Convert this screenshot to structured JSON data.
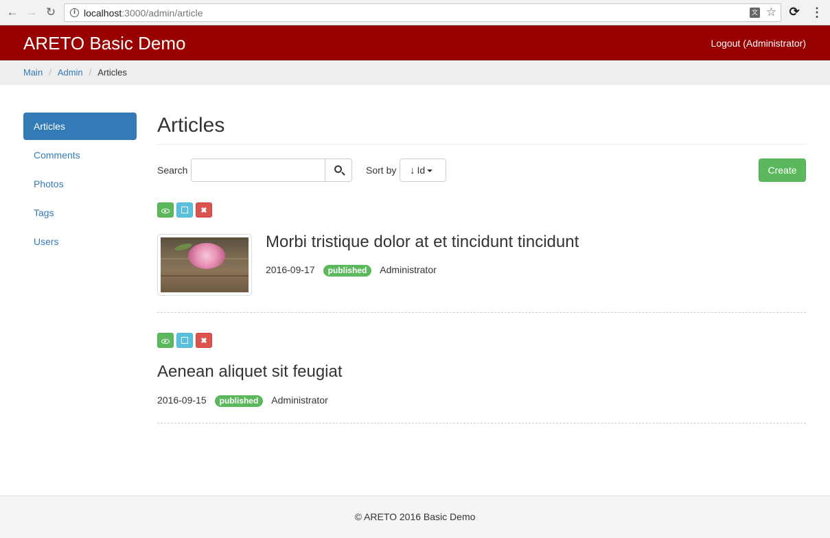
{
  "browser": {
    "url_host": "localhost",
    "url_rest": ":3000/admin/article"
  },
  "navbar": {
    "brand": "ARETO Basic Demo",
    "logout": "Logout (Administrator)"
  },
  "breadcrumb": {
    "items": [
      "Main",
      "Admin",
      "Articles"
    ]
  },
  "sidebar": {
    "items": [
      {
        "label": "Articles",
        "active": true
      },
      {
        "label": "Comments"
      },
      {
        "label": "Photos"
      },
      {
        "label": "Tags"
      },
      {
        "label": "Users"
      }
    ]
  },
  "main": {
    "title": "Articles",
    "search_label": "Search",
    "search_value": "",
    "sort_label": "Sort by",
    "sort_value": "Id",
    "create_label": "Create"
  },
  "articles": [
    {
      "title": "Morbi tristique dolor at et tincidunt tincidunt",
      "date": "2016-09-17",
      "status": "published",
      "author": "Administrator"
    },
    {
      "title": "Aenean aliquet sit feugiat",
      "date": "2016-09-15",
      "status": "published",
      "author": "Administrator"
    }
  ],
  "footer": {
    "text": "© ARETO 2016 Basic Demo"
  },
  "colors": {
    "navbar": "#990000",
    "primary": "#337ab7",
    "success": "#5cb85c",
    "info": "#5bc0de",
    "danger": "#d9534f"
  }
}
